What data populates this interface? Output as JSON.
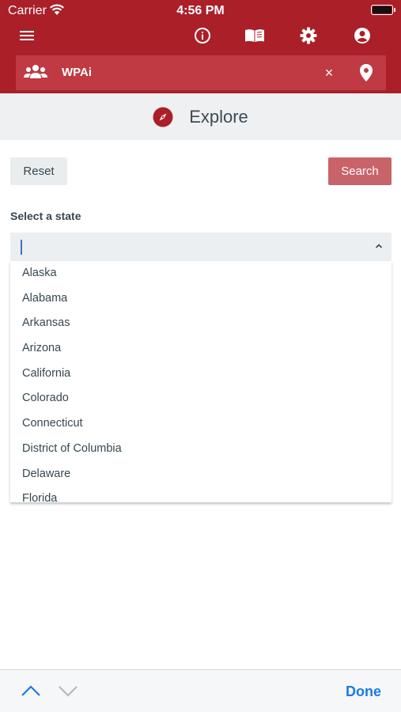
{
  "status_bar": {
    "carrier": "Carrier",
    "time": "4:56 PM"
  },
  "toolbar": {
    "icons": [
      "menu-icon",
      "info-icon",
      "book-icon",
      "gear-icon",
      "account-icon"
    ]
  },
  "search_bar": {
    "query": "WPAi",
    "clear_symbol": "×"
  },
  "explore": {
    "title": "Explore"
  },
  "buttons": {
    "reset": "Reset",
    "search": "Search"
  },
  "state_select": {
    "label": "Select a state",
    "value": "",
    "options": [
      "Alaska",
      "Alabama",
      "Arkansas",
      "Arizona",
      "California",
      "Colorado",
      "Connecticut",
      "District of Columbia",
      "Delaware",
      "Florida"
    ]
  },
  "keyboard_bar": {
    "done": "Done"
  },
  "colors": {
    "brand_red": "#ab1f28",
    "search_bar_bg": "#bf3a42",
    "search_button": "#c9636a",
    "done_blue": "#1a7be6"
  }
}
